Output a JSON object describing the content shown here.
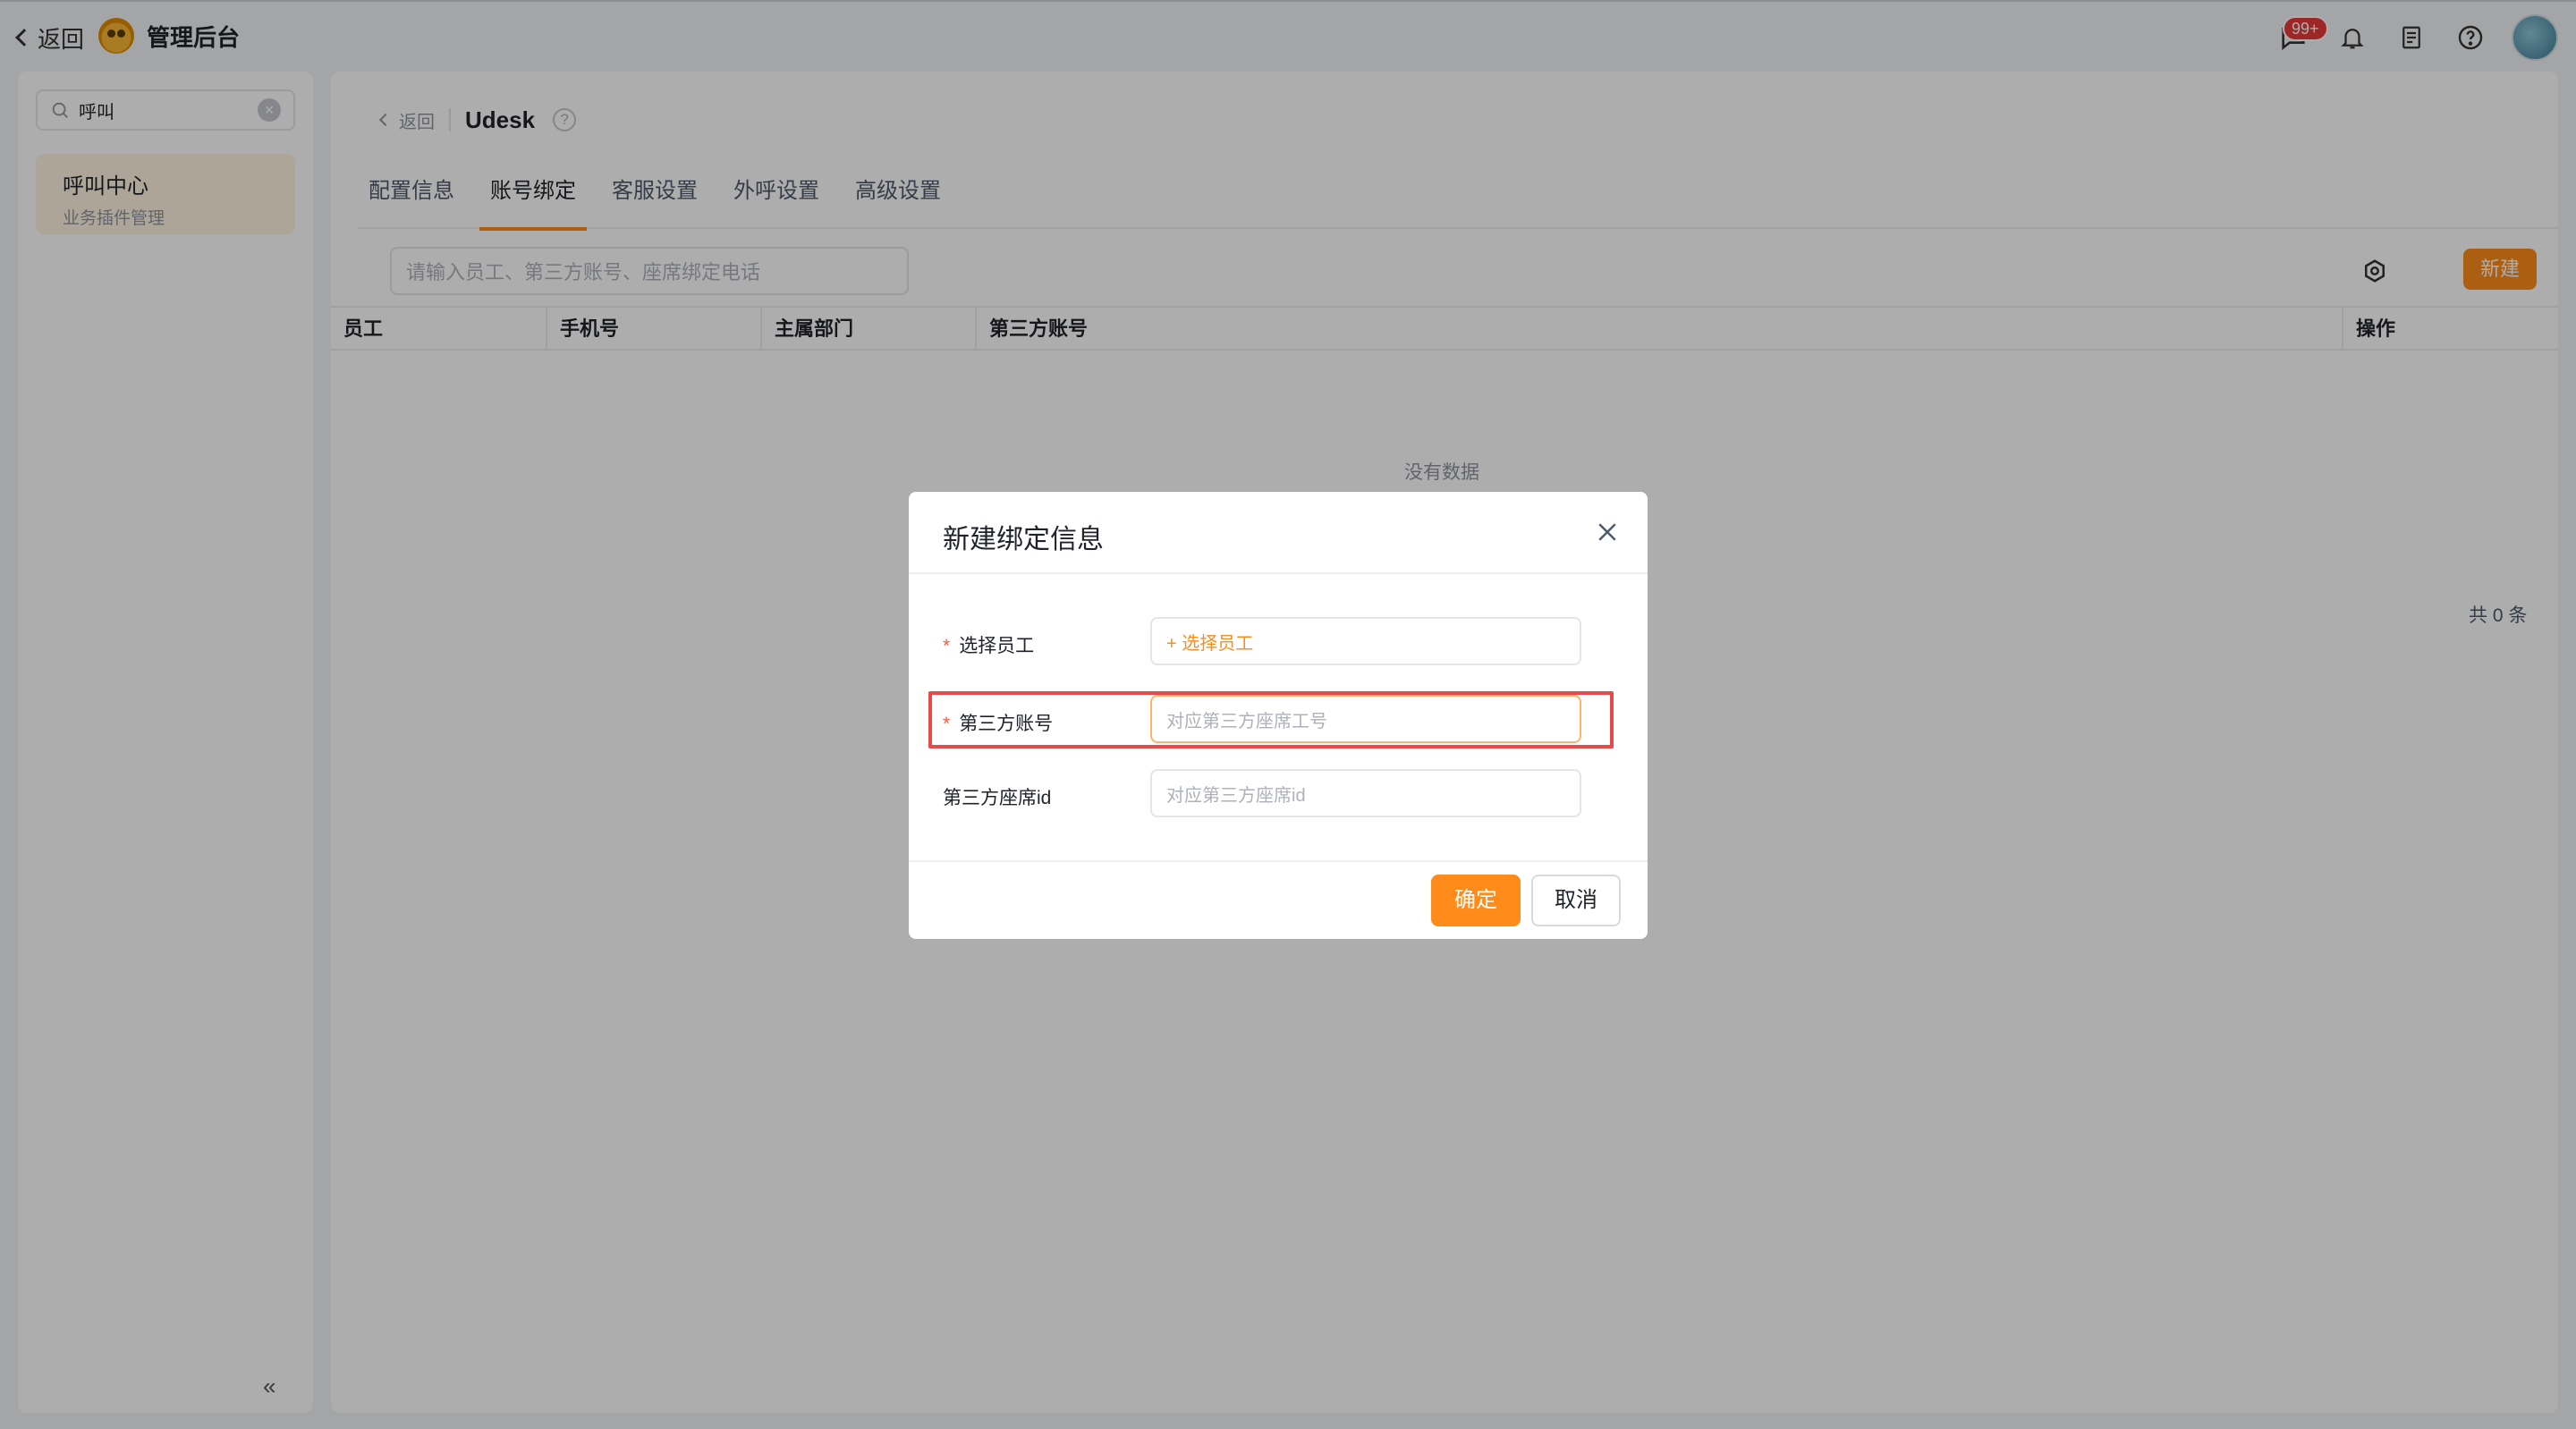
{
  "topbar": {
    "back_label": "返回",
    "title": "管理后台",
    "badge": "99+",
    "icons": [
      "chat-icon",
      "bell-icon",
      "notes-icon",
      "help-icon",
      "avatar"
    ]
  },
  "sidebar": {
    "search_value": "呼叫",
    "item_title": "呼叫中心",
    "item_subtitle": "业务插件管理",
    "collapse_label": "«"
  },
  "main": {
    "back_label": "返回",
    "title": "Udesk",
    "help_label": "?",
    "tabs": [
      "配置信息",
      "账号绑定",
      "客服设置",
      "外呼设置",
      "高级设置"
    ],
    "active_tab": 1,
    "search_placeholder": "请输入员工、第三方账号、座席绑定电话",
    "new_label": "新建",
    "columns": [
      "员工",
      "手机号",
      "主属部门",
      "第三方账号",
      "操作"
    ],
    "empty_text": "没有数据",
    "total_text": "共 0 条"
  },
  "modal": {
    "title": "新建绑定信息",
    "fields": [
      {
        "label": "选择员工",
        "required": "*",
        "value": "+ 选择员工"
      },
      {
        "label": "第三方账号",
        "required": "*",
        "placeholder": "对应第三方座席工号"
      },
      {
        "label": "第三方座席id",
        "placeholder": "对应第三方座席id"
      }
    ],
    "ok_label": "确定",
    "cancel_label": "取消"
  },
  "colors": {
    "accent": "#ff8c1a",
    "highlight": "#e84a4a",
    "badge": "#e83a3a"
  }
}
